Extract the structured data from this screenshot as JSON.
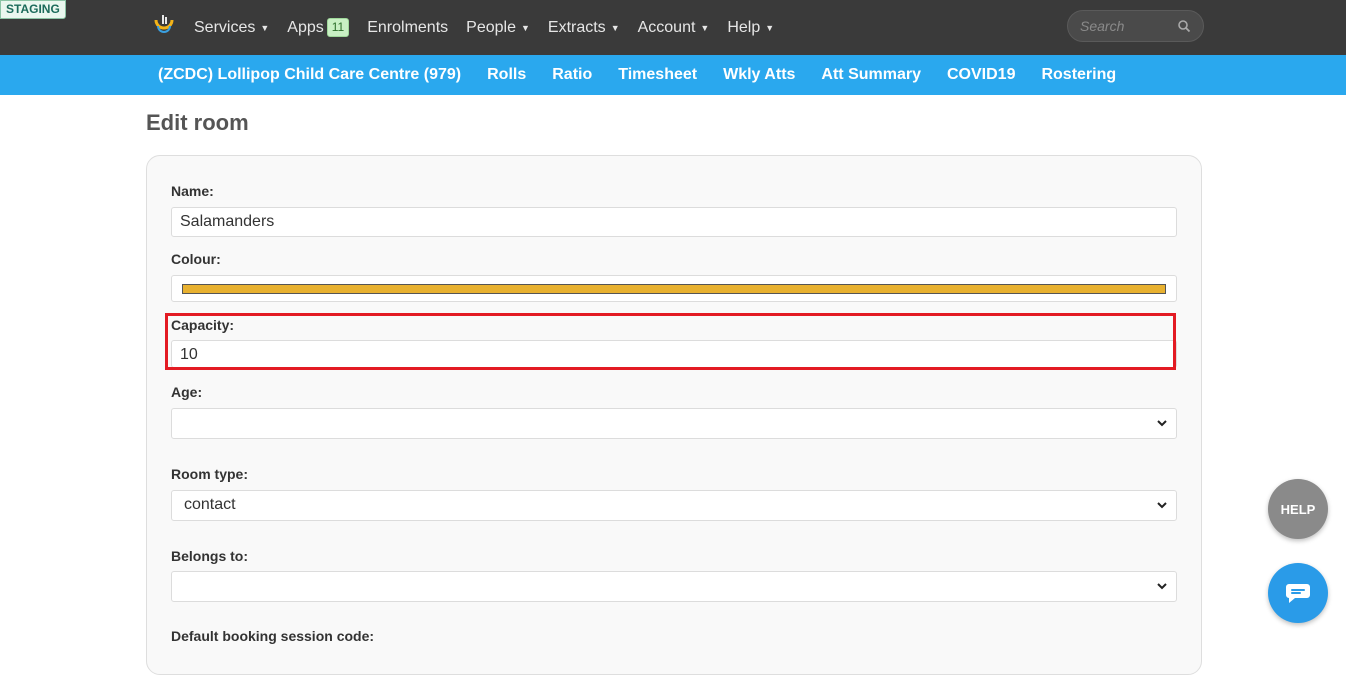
{
  "env_badge": "STAGING",
  "topnav": {
    "items": [
      {
        "label": "Services",
        "caret": true
      },
      {
        "label": "Apps",
        "badge": "11"
      },
      {
        "label": "Enrolments"
      },
      {
        "label": "People",
        "caret": true
      },
      {
        "label": "Extracts",
        "caret": true
      },
      {
        "label": "Account",
        "caret": true
      },
      {
        "label": "Help",
        "caret": true
      }
    ],
    "search_placeholder": "Search"
  },
  "subnav": {
    "items": [
      "(ZCDC) Lollipop Child Care Centre (979)",
      "Rolls",
      "Ratio",
      "Timesheet",
      "Wkly Atts",
      "Att Summary",
      "COVID19",
      "Rostering"
    ]
  },
  "page": {
    "title": "Edit room"
  },
  "form": {
    "name_label": "Name:",
    "name_value": "Salamanders",
    "colour_label": "Colour:",
    "colour_value": "#e8b130",
    "capacity_label": "Capacity:",
    "capacity_value": "10",
    "age_label": "Age:",
    "age_value": "",
    "room_type_label": "Room type:",
    "room_type_value": "contact",
    "belongs_to_label": "Belongs to:",
    "belongs_to_value": "",
    "default_booking_label": "Default booking session code:"
  },
  "floating": {
    "help_label": "HELP"
  },
  "colors": {
    "topbar": "#3a3a3a",
    "subbar": "#2aa8ee",
    "highlight": "#e31b23"
  }
}
